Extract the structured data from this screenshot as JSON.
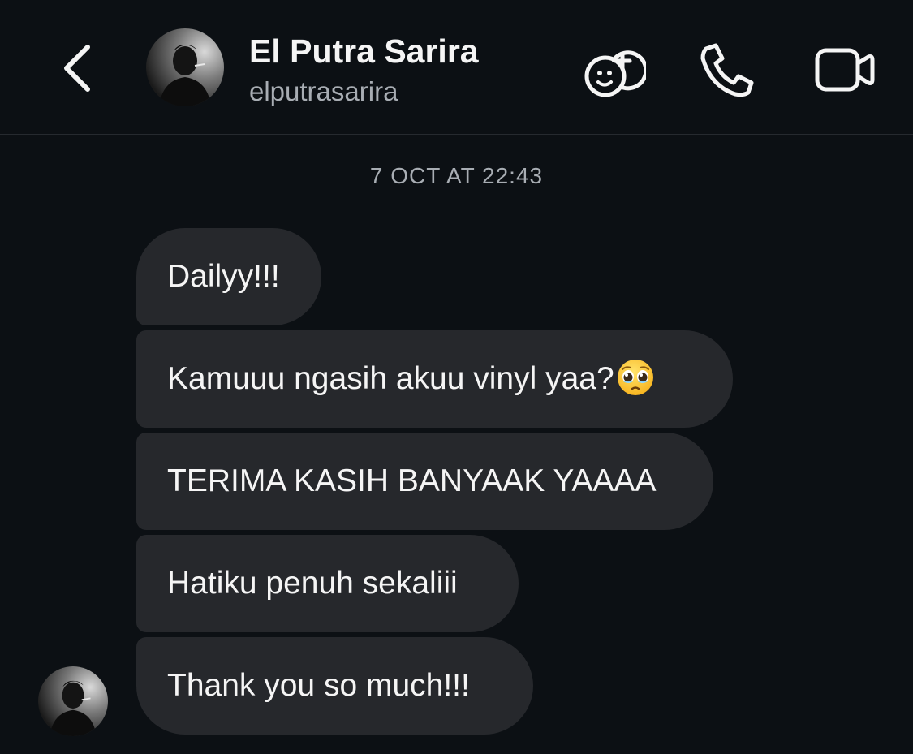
{
  "header": {
    "contact_name": "El Putra Sarira",
    "contact_handle": "elputrasarira",
    "icons": {
      "back": "chevron-left-icon",
      "effects": "effects-add-icon",
      "call": "phone-icon",
      "video": "video-camera-icon"
    }
  },
  "thread": {
    "timestamp": "7 OCT AT 22:43",
    "messages": [
      {
        "text": "Dailyy!!!"
      },
      {
        "text": "Kamuuu ngasih akuu vinyl yaa?",
        "emoji": "pleading-face-emoji"
      },
      {
        "text": "TERIMA KASIH BANYAAK YAAAA"
      },
      {
        "text": "Hatiku penuh sekaliii"
      },
      {
        "text": "Thank you so much!!!"
      }
    ]
  },
  "colors": {
    "background": "#0c1014",
    "bubble": "#26282c",
    "primary_text": "#f5f5f5",
    "secondary_text": "#a8adb3",
    "divider": "#262a2f"
  }
}
